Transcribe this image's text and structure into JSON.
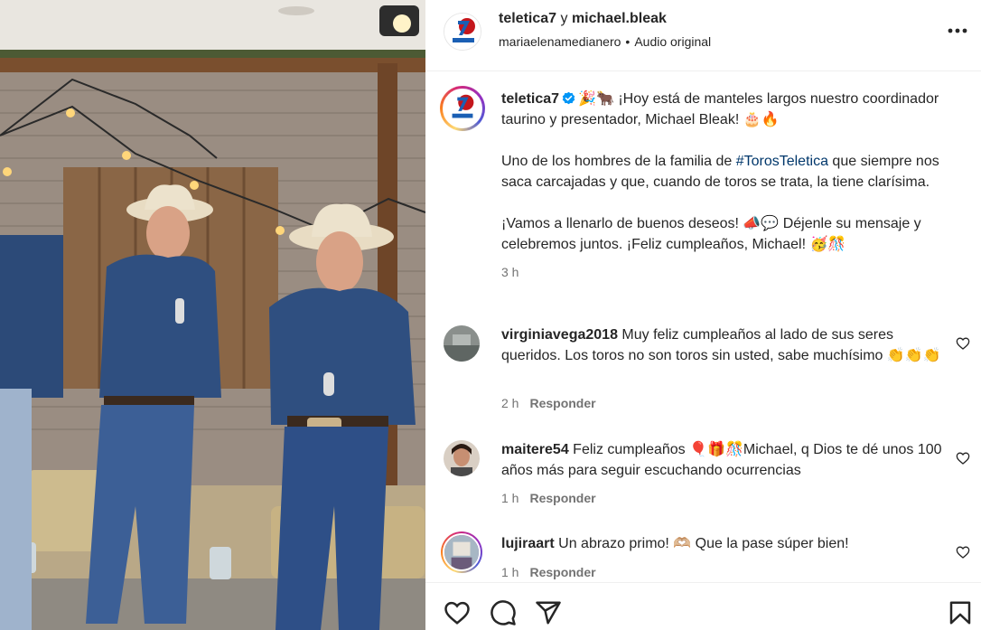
{
  "post_header": {
    "account_primary": "teletica7",
    "conjunction": "y",
    "account_secondary": "michael.bleak",
    "audio_owner": "mariaelenamedianero",
    "separator": "•",
    "audio_label": "Audio original"
  },
  "caption": {
    "username": "teletica7",
    "line1": "🎉🐂 ¡Hoy está de manteles largos nuestro coordinador taurino y presentador, Michael Bleak! 🎂🔥",
    "para2_before": "Uno de los hombres de la familia de ",
    "hashtag": "#TorosTeletica",
    "para2_after": " que siempre nos saca carcajadas y que, cuando de toros se trata, la tiene clarísima.",
    "para3": "¡Vamos a llenarlo de buenos deseos! 📣💬 Déjenle su mensaje y celebremos juntos. ¡Feliz cumpleaños, Michael! 🥳🎊",
    "time": "3 h"
  },
  "comments": [
    {
      "username": "virginiavega2018",
      "text": "Muy feliz cumpleaños al lado de sus seres queridos. Los toros no son toros sin usted, sabe muchísimo 👏👏👏",
      "time": "2 h",
      "reply_label": "Responder"
    },
    {
      "username": "maitere54",
      "text": "Feliz cumpleaños 🎈🎁🎊Michael, q Dios te dé unos 100 años más para seguir escuchando ocurrencias",
      "time": "1 h",
      "reply_label": "Responder"
    },
    {
      "username": "lujiraart",
      "text": "Un abrazo primo! 🫶🏼 Que la pase súper bien!",
      "time": "1 h",
      "reply_label": "Responder"
    }
  ],
  "icons": {
    "more": "more-options-icon",
    "verified": "verified-badge-icon",
    "like": "heart-icon",
    "comment": "comment-icon",
    "share": "share-icon",
    "save": "bookmark-icon"
  },
  "colors": {
    "text": "#262626",
    "secondary": "#737373",
    "hashtag": "#00376b",
    "verified": "#0095f6"
  }
}
